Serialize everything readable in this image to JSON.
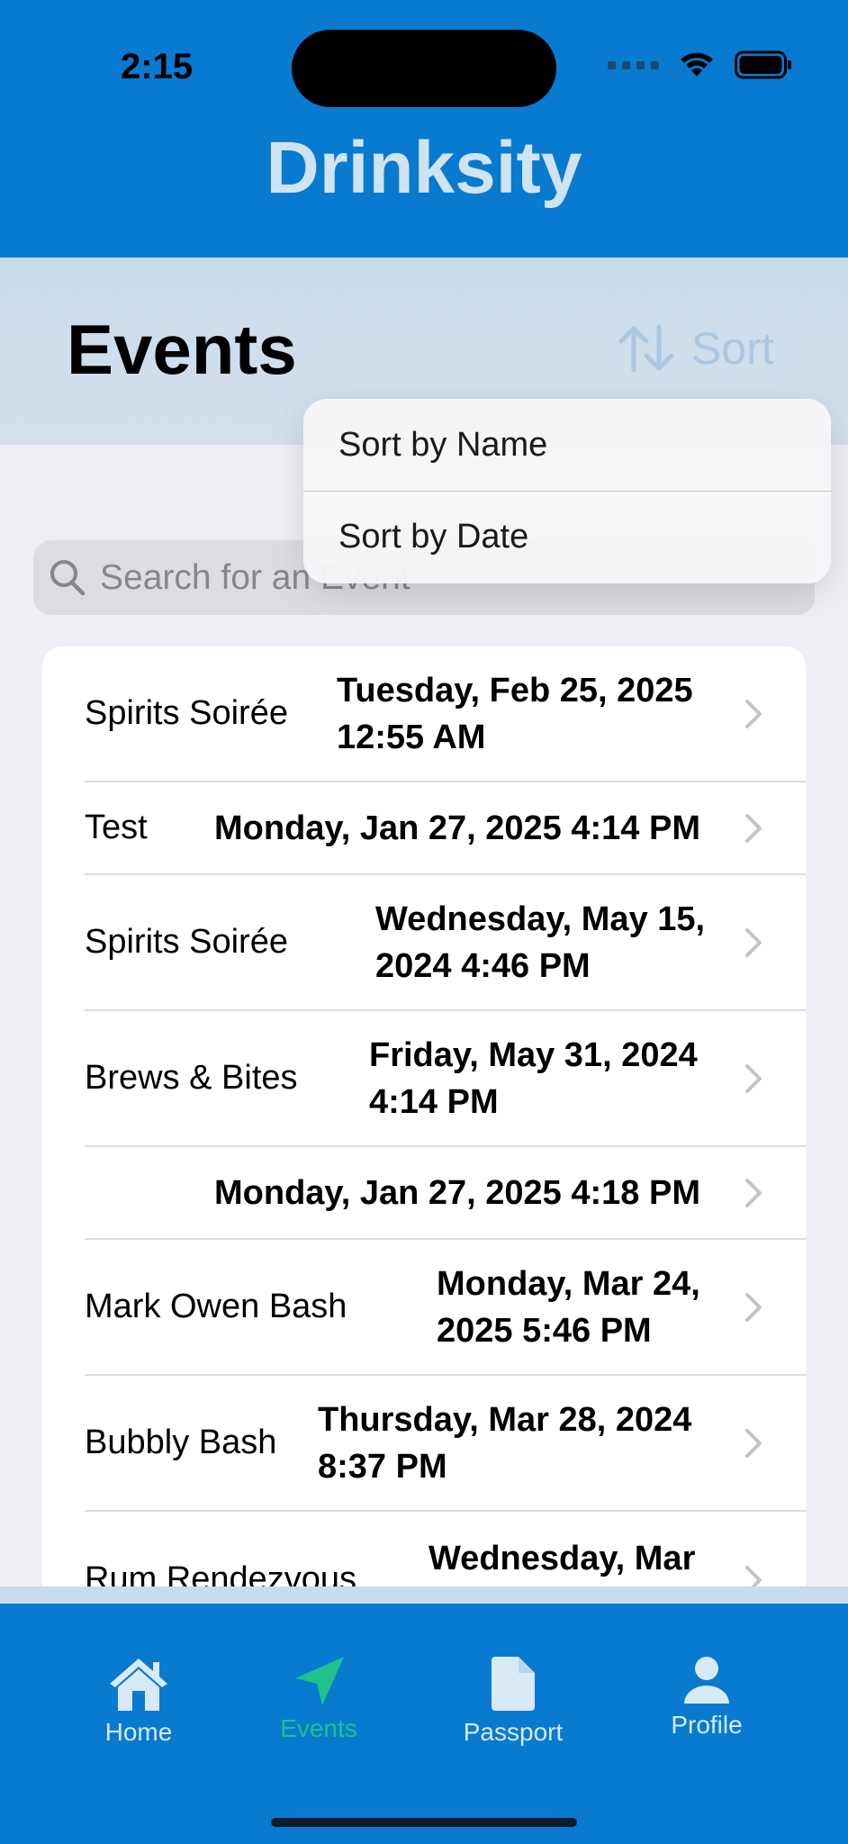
{
  "status": {
    "time": "2:15"
  },
  "app": {
    "title": "Drinksity",
    "accent": "#087acf",
    "active_tab_color": "#1fc08a"
  },
  "header": {
    "title": "Events",
    "sort_label": "Sort"
  },
  "sort_menu": {
    "items": [
      "Sort by Name",
      "Sort by Date"
    ]
  },
  "search": {
    "placeholder": "Search for an Event"
  },
  "events": [
    {
      "name": "Spirits Soirée",
      "date": "Tuesday, Feb 25, 2025 12:55 AM"
    },
    {
      "name": "Test",
      "date": "Monday, Jan 27, 2025 4:14 PM"
    },
    {
      "name": "Spirits Soirée",
      "date": "Wednesday, May 15, 2024 4:46 PM"
    },
    {
      "name": "Brews & Bites",
      "date": "Friday, May 31, 2024 4:14 PM"
    },
    {
      "name": "",
      "date": "Monday, Jan 27, 2025 4:18 PM"
    },
    {
      "name": "Mark Owen Bash",
      "date": "Monday, Mar 24, 2025 5:46 PM"
    },
    {
      "name": "Bubbly Bash",
      "date": "Thursday, Mar 28, 2024 8:37 PM"
    },
    {
      "name": "Rum Rendezvous",
      "date": "Wednesday, Mar"
    }
  ],
  "tabs": [
    {
      "label": "Home",
      "icon": "house-icon"
    },
    {
      "label": "Events",
      "icon": "location-arrow-icon"
    },
    {
      "label": "Passport",
      "icon": "document-icon"
    },
    {
      "label": "Profile",
      "icon": "person-icon"
    }
  ]
}
